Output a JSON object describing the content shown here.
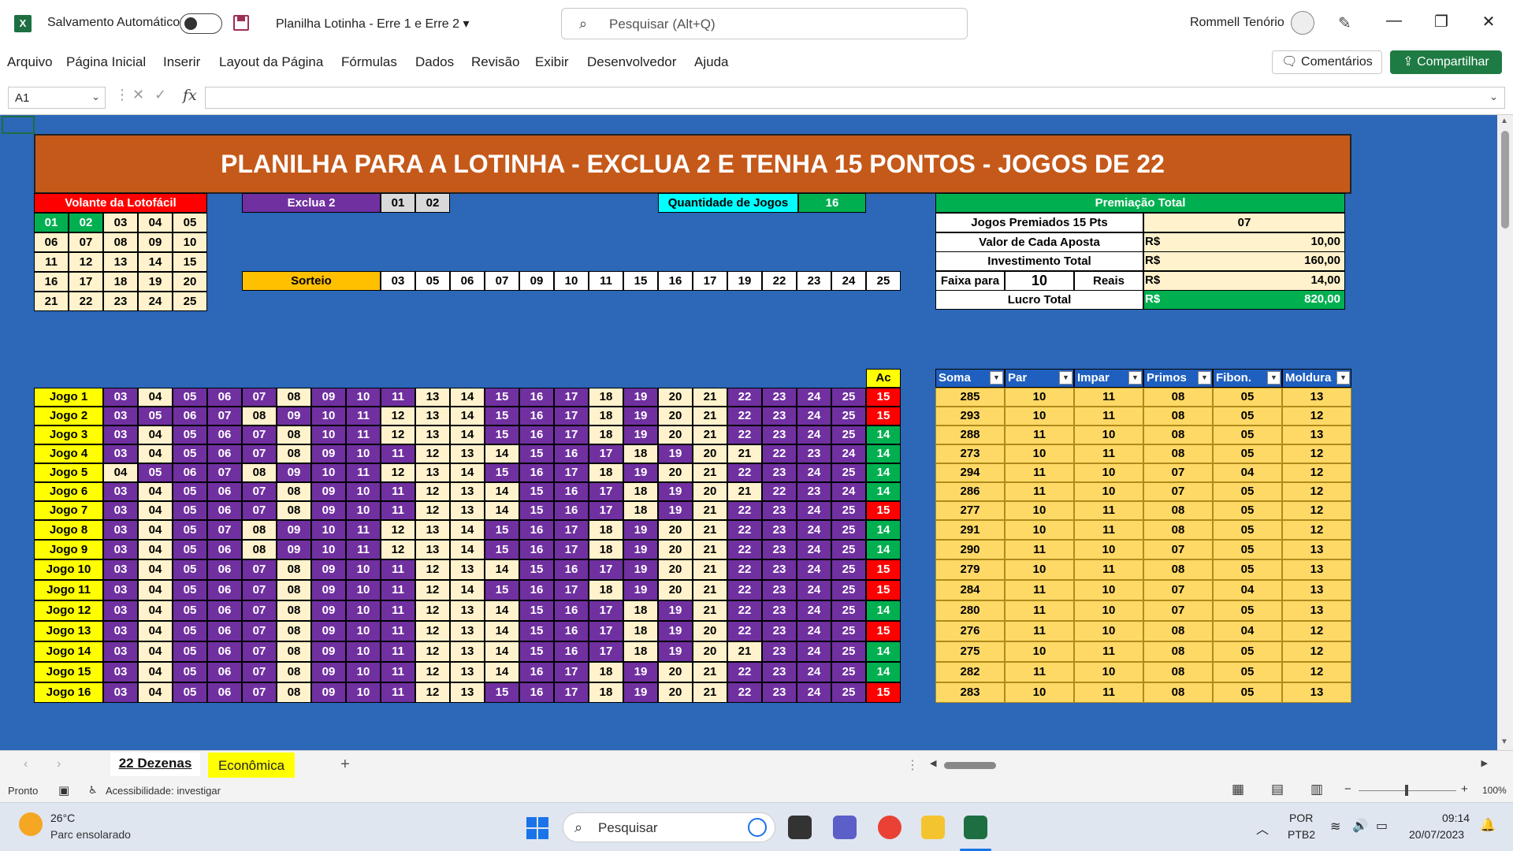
{
  "window": {
    "autosave_label": "Salvamento Automático",
    "doc_title": "Planilha Lotinha - Erre 1 e Erre 2",
    "search_placeholder": "Pesquisar (Alt+Q)",
    "user": "Rommell Tenório"
  },
  "menu": {
    "items": [
      "Arquivo",
      "Página Inicial",
      "Inserir",
      "Layout da Página",
      "Fórmulas",
      "Dados",
      "Revisão",
      "Exibir",
      "Desenvolvedor",
      "Ajuda"
    ],
    "comments": "Comentários",
    "share": "Compartilhar"
  },
  "formula_bar": {
    "name_box": "A1",
    "fx": "fx",
    "content": ""
  },
  "sheet": {
    "title": "PLANILHA PARA A LOTINHA - EXCLUA 2 E TENHA 15 PONTOS - JOGOS DE 22",
    "volante": {
      "header": "Volante da Lotofácil",
      "rows": [
        [
          "01",
          "02",
          "03",
          "04",
          "05"
        ],
        [
          "06",
          "07",
          "08",
          "09",
          "10"
        ],
        [
          "11",
          "12",
          "13",
          "14",
          "15"
        ],
        [
          "16",
          "17",
          "18",
          "19",
          "20"
        ],
        [
          "21",
          "22",
          "23",
          "24",
          "25"
        ]
      ]
    },
    "exclua": {
      "label": "Exclua 2",
      "values": [
        "01",
        "02"
      ]
    },
    "sorteio": {
      "label": "Sorteio",
      "values": [
        "03",
        "05",
        "06",
        "07",
        "09",
        "10",
        "11",
        "15",
        "16",
        "17",
        "19",
        "22",
        "23",
        "24",
        "25"
      ]
    },
    "quantidade": {
      "label": "Quantidade de Jogos",
      "value": "16"
    },
    "premiacao": {
      "header": "Premiação Total",
      "rows": [
        {
          "label": "Jogos Premiados 15 Pts",
          "value": "07"
        },
        {
          "label": "Valor de Cada Aposta",
          "currency": "R$",
          "value": "10,00"
        },
        {
          "label": "Investimento Total",
          "currency": "R$",
          "value": "160,00"
        },
        {
          "label": "Faixa para",
          "mid": "10",
          "label2": "Reais",
          "currency": "R$",
          "value": "14,00"
        },
        {
          "label": "Lucro Total",
          "currency": "R$",
          "value": "820,00"
        }
      ]
    },
    "ac_header": "Ac",
    "games": [
      {
        "name": "Jogo 1",
        "nums": [
          "03",
          "04",
          "05",
          "06",
          "07",
          "08",
          "09",
          "10",
          "11",
          "13",
          "14",
          "15",
          "16",
          "17",
          "18",
          "19",
          "20",
          "21",
          "22",
          "23",
          "24",
          "25"
        ],
        "ac": "15"
      },
      {
        "name": "Jogo 2",
        "nums": [
          "03",
          "05",
          "06",
          "07",
          "08",
          "09",
          "10",
          "11",
          "12",
          "13",
          "14",
          "15",
          "16",
          "17",
          "18",
          "19",
          "20",
          "21",
          "22",
          "23",
          "24",
          "25"
        ],
        "ac": "15"
      },
      {
        "name": "Jogo 3",
        "nums": [
          "03",
          "04",
          "05",
          "06",
          "07",
          "08",
          "10",
          "11",
          "12",
          "13",
          "14",
          "15",
          "16",
          "17",
          "18",
          "19",
          "20",
          "21",
          "22",
          "23",
          "24",
          "25"
        ],
        "ac": "14"
      },
      {
        "name": "Jogo 4",
        "nums": [
          "03",
          "04",
          "05",
          "06",
          "07",
          "08",
          "09",
          "10",
          "11",
          "12",
          "13",
          "14",
          "15",
          "16",
          "17",
          "18",
          "19",
          "20",
          "21",
          "22",
          "23",
          "24"
        ],
        "ac": "14"
      },
      {
        "name": "Jogo 5",
        "nums": [
          "04",
          "05",
          "06",
          "07",
          "08",
          "09",
          "10",
          "11",
          "12",
          "13",
          "14",
          "15",
          "16",
          "17",
          "18",
          "19",
          "20",
          "21",
          "22",
          "23",
          "24",
          "25"
        ],
        "ac": "14"
      },
      {
        "name": "Jogo 6",
        "nums": [
          "03",
          "04",
          "05",
          "06",
          "07",
          "08",
          "09",
          "10",
          "11",
          "12",
          "13",
          "14",
          "15",
          "16",
          "17",
          "18",
          "19",
          "20",
          "21",
          "22",
          "23",
          "24"
        ],
        "ac": "14"
      },
      {
        "name": "Jogo 7",
        "nums": [
          "03",
          "04",
          "05",
          "06",
          "07",
          "08",
          "09",
          "10",
          "11",
          "12",
          "13",
          "14",
          "15",
          "16",
          "17",
          "18",
          "19",
          "21",
          "22",
          "23",
          "24",
          "25"
        ],
        "ac": "15"
      },
      {
        "name": "Jogo 8",
        "nums": [
          "03",
          "04",
          "05",
          "07",
          "08",
          "09",
          "10",
          "11",
          "12",
          "13",
          "14",
          "15",
          "16",
          "17",
          "18",
          "19",
          "20",
          "21",
          "22",
          "23",
          "24",
          "25"
        ],
        "ac": "14"
      },
      {
        "name": "Jogo 9",
        "nums": [
          "03",
          "04",
          "05",
          "06",
          "08",
          "09",
          "10",
          "11",
          "12",
          "13",
          "14",
          "15",
          "16",
          "17",
          "18",
          "19",
          "20",
          "21",
          "22",
          "23",
          "24",
          "25"
        ],
        "ac": "14"
      },
      {
        "name": "Jogo 10",
        "nums": [
          "03",
          "04",
          "05",
          "06",
          "07",
          "08",
          "09",
          "10",
          "11",
          "12",
          "13",
          "14",
          "15",
          "16",
          "17",
          "19",
          "20",
          "21",
          "22",
          "23",
          "24",
          "25"
        ],
        "ac": "15"
      },
      {
        "name": "Jogo 11",
        "nums": [
          "03",
          "04",
          "05",
          "06",
          "07",
          "08",
          "09",
          "10",
          "11",
          "12",
          "14",
          "15",
          "16",
          "17",
          "18",
          "19",
          "20",
          "21",
          "22",
          "23",
          "24",
          "25"
        ],
        "ac": "15"
      },
      {
        "name": "Jogo 12",
        "nums": [
          "03",
          "04",
          "05",
          "06",
          "07",
          "08",
          "09",
          "10",
          "11",
          "12",
          "13",
          "14",
          "15",
          "16",
          "17",
          "18",
          "19",
          "21",
          "22",
          "23",
          "24",
          "25"
        ],
        "ac": "14"
      },
      {
        "name": "Jogo 13",
        "nums": [
          "03",
          "04",
          "05",
          "06",
          "07",
          "08",
          "09",
          "10",
          "11",
          "12",
          "13",
          "14",
          "15",
          "16",
          "17",
          "18",
          "19",
          "20",
          "22",
          "23",
          "24",
          "25"
        ],
        "ac": "15"
      },
      {
        "name": "Jogo 14",
        "nums": [
          "03",
          "04",
          "05",
          "06",
          "07",
          "08",
          "09",
          "10",
          "11",
          "12",
          "13",
          "14",
          "15",
          "16",
          "17",
          "18",
          "19",
          "20",
          "21",
          "23",
          "24",
          "25"
        ],
        "ac": "14"
      },
      {
        "name": "Jogo 15",
        "nums": [
          "03",
          "04",
          "05",
          "06",
          "07",
          "08",
          "09",
          "10",
          "11",
          "12",
          "13",
          "14",
          "16",
          "17",
          "18",
          "19",
          "20",
          "21",
          "22",
          "23",
          "24",
          "25"
        ],
        "ac": "14"
      },
      {
        "name": "Jogo 16",
        "nums": [
          "03",
          "04",
          "05",
          "06",
          "07",
          "08",
          "09",
          "10",
          "11",
          "12",
          "13",
          "15",
          "16",
          "17",
          "18",
          "19",
          "20",
          "21",
          "22",
          "23",
          "24",
          "25"
        ],
        "ac": "15"
      }
    ],
    "stats": {
      "headers": [
        "Soma",
        "Par",
        "Impar",
        "Primos",
        "Fibon.",
        "Moldura"
      ],
      "rows": [
        [
          "285",
          "10",
          "11",
          "08",
          "05",
          "13"
        ],
        [
          "293",
          "10",
          "11",
          "08",
          "05",
          "12"
        ],
        [
          "288",
          "11",
          "10",
          "08",
          "05",
          "13"
        ],
        [
          "273",
          "10",
          "11",
          "08",
          "05",
          "12"
        ],
        [
          "294",
          "11",
          "10",
          "07",
          "04",
          "12"
        ],
        [
          "286",
          "11",
          "10",
          "07",
          "05",
          "12"
        ],
        [
          "277",
          "10",
          "11",
          "08",
          "05",
          "12"
        ],
        [
          "291",
          "10",
          "11",
          "08",
          "05",
          "12"
        ],
        [
          "290",
          "11",
          "10",
          "07",
          "05",
          "13"
        ],
        [
          "279",
          "10",
          "11",
          "08",
          "05",
          "13"
        ],
        [
          "284",
          "11",
          "10",
          "07",
          "04",
          "13"
        ],
        [
          "280",
          "11",
          "10",
          "07",
          "05",
          "13"
        ],
        [
          "276",
          "11",
          "10",
          "08",
          "04",
          "12"
        ],
        [
          "275",
          "10",
          "11",
          "08",
          "05",
          "12"
        ],
        [
          "282",
          "11",
          "10",
          "08",
          "05",
          "12"
        ],
        [
          "283",
          "10",
          "11",
          "08",
          "05",
          "13"
        ]
      ]
    }
  },
  "tabs": {
    "active": "22 Dezenas",
    "other": "Econômica"
  },
  "status": {
    "ready": "Pronto",
    "accessibility": "Acessibilidade: investigar",
    "zoom": "100%"
  },
  "taskbar": {
    "temp": "26°C",
    "weather": "Parc ensolarado",
    "search": "Pesquisar",
    "lang1": "POR",
    "lang2": "PTB2",
    "time": "09:14",
    "date": "20/07/2023"
  },
  "colors": {
    "sheet_bg": "#2c67b8",
    "purple": "#7030a0",
    "cream": "#fff2cc",
    "yellow": "#ffff00",
    "green": "#00b050",
    "red": "#ff0000",
    "orange_banner": "#c5591a",
    "orange": "#ffc000",
    "cyan": "#00ffff",
    "stat_fill": "#ffd966",
    "header_blue": "#1f5fbf"
  }
}
